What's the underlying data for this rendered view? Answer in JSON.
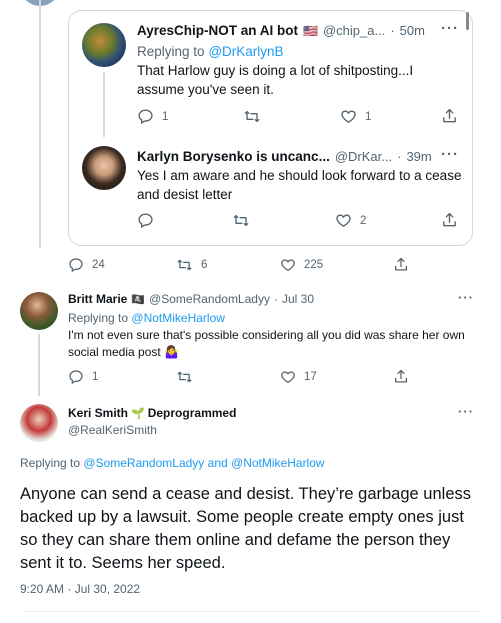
{
  "quoted_thread": {
    "tweet1": {
      "name": "AyresChip-NOT an AI bot",
      "flag": "🇺🇸",
      "handle": "@chip_a...",
      "dot": "·",
      "time": "50m",
      "replying_prefix": "Replying to",
      "replying_to": "@DrKarlynB",
      "text": "That Harlow guy is doing a lot of shitposting...I assume you've seen it.",
      "reply_count": "1",
      "retweet_count": "",
      "like_count": "1"
    },
    "tweet2": {
      "name": "Karlyn Borysenko is uncanc...",
      "handle": "@DrKar...",
      "dot": "·",
      "time": "39m",
      "text": "Yes I am aware and he should look forward to a cease and desist letter",
      "reply_count": "",
      "retweet_count": "",
      "like_count": "2"
    }
  },
  "parent_actions": {
    "reply_count": "24",
    "retweet_count": "6",
    "like_count": "225"
  },
  "reply_britt": {
    "name": "Britt Marie",
    "name_emoji": "🏴‍☠️",
    "handle": "@SomeRandomLadyy",
    "dot": "·",
    "time": "Jul 30",
    "replying_prefix": "Replying to",
    "replying_to": "@NotMikeHarlow",
    "text": "I'm not even sure that's possible considering all you did was share her own social media post 🤷‍♀️",
    "reply_count": "1",
    "retweet_count": "",
    "like_count": "17"
  },
  "main_tweet": {
    "name": "Keri Smith",
    "name_emoji": "🌱",
    "name_suffix": "Deprogrammed",
    "handle": "@RealKeriSmith",
    "replying_prefix": "Replying to",
    "replying_to_1": "@SomeRandomLadyy",
    "replying_and": "and",
    "replying_to_2": "@NotMikeHarlow",
    "text": "Anyone can send a cease and desist. They’re garbage unless backed up by a lawsuit. Some people create empty ones just so they can share them online and defame the person they sent it to. Seems her speed.",
    "timestamp": "9:20 AM · Jul 30, 2022"
  },
  "icons": {
    "reply": "reply-icon",
    "retweet": "retweet-icon",
    "like": "heart-icon",
    "share": "share-icon",
    "more": "more-icon"
  },
  "colors": {
    "link": "#1d9bf0",
    "muted": "#536471",
    "border": "#cfd9de"
  }
}
